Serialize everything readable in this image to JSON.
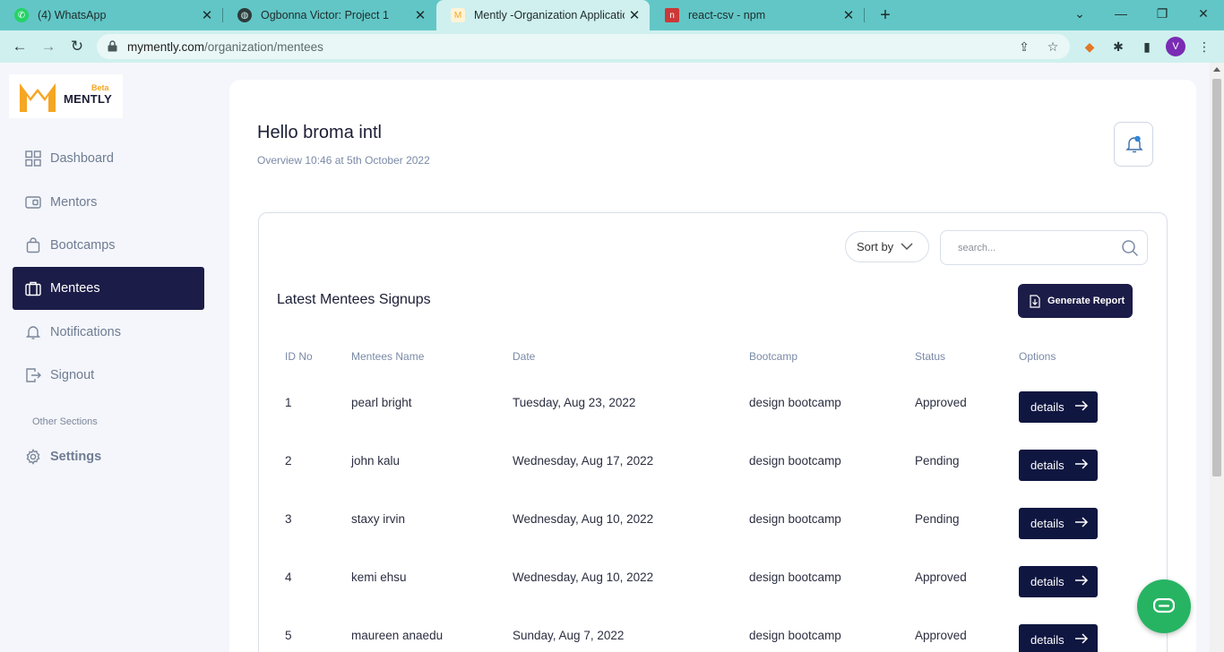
{
  "browser": {
    "tabs": [
      {
        "title": "(4) WhatsApp",
        "icon": "whatsapp-icon",
        "active": false
      },
      {
        "title": "Ogbonna Victor: Project 1",
        "icon": "globe-icon",
        "active": false
      },
      {
        "title": "Mently -Organization Application",
        "icon": "mently-icon",
        "active": true
      },
      {
        "title": "react-csv - npm",
        "icon": "npm-icon",
        "active": false
      }
    ],
    "url_host": "mymently.com",
    "url_path": "/organization/mentees",
    "profile_initial": "V"
  },
  "logo": {
    "beta": "Beta",
    "brand": "MENTLY"
  },
  "sidebar": {
    "items": [
      {
        "label": "Dashboard",
        "icon": "dashboard-icon"
      },
      {
        "label": "Mentors",
        "icon": "wallet-icon"
      },
      {
        "label": "Bootcamps",
        "icon": "bag-icon"
      },
      {
        "label": "Mentees",
        "icon": "briefcase-icon",
        "active": true
      },
      {
        "label": "Notifications",
        "icon": "bell-icon"
      },
      {
        "label": "Signout",
        "icon": "signout-icon"
      }
    ],
    "section_label": "Other Sections",
    "settings_label": "Settings"
  },
  "header": {
    "greeting": "Hello broma intl",
    "overview": "Overview 10:46 at 5th October 2022"
  },
  "toolbar": {
    "sort_label": "Sort by",
    "search_placeholder": "search...",
    "section_title": "Latest Mentees Signups",
    "generate_label": "Generate Report"
  },
  "table": {
    "columns": [
      "ID No",
      "Mentees Name",
      "Date",
      "Bootcamp",
      "Status",
      "Options"
    ],
    "rows": [
      {
        "id": "1",
        "name": "pearl bright",
        "date": "Tuesday, Aug 23, 2022",
        "bootcamp": "design bootcamp",
        "status": "Approved",
        "action": "details"
      },
      {
        "id": "2",
        "name": "john kalu",
        "date": "Wednesday, Aug 17, 2022",
        "bootcamp": "design bootcamp",
        "status": "Pending",
        "action": "details"
      },
      {
        "id": "3",
        "name": "staxy irvin",
        "date": "Wednesday, Aug 10, 2022",
        "bootcamp": "design bootcamp",
        "status": "Pending",
        "action": "details"
      },
      {
        "id": "4",
        "name": "kemi ehsu",
        "date": "Wednesday, Aug 10, 2022",
        "bootcamp": "design bootcamp",
        "status": "Approved",
        "action": "details"
      },
      {
        "id": "5",
        "name": "maureen anaedu",
        "date": "Sunday, Aug 7, 2022",
        "bootcamp": "design bootcamp",
        "status": "Approved",
        "action": "details"
      }
    ]
  },
  "colors": {
    "accent_dark": "#1c1c48",
    "brand_orange": "#f5a623",
    "chat_green": "#26b463",
    "tabstrip": "#62c6c6"
  }
}
